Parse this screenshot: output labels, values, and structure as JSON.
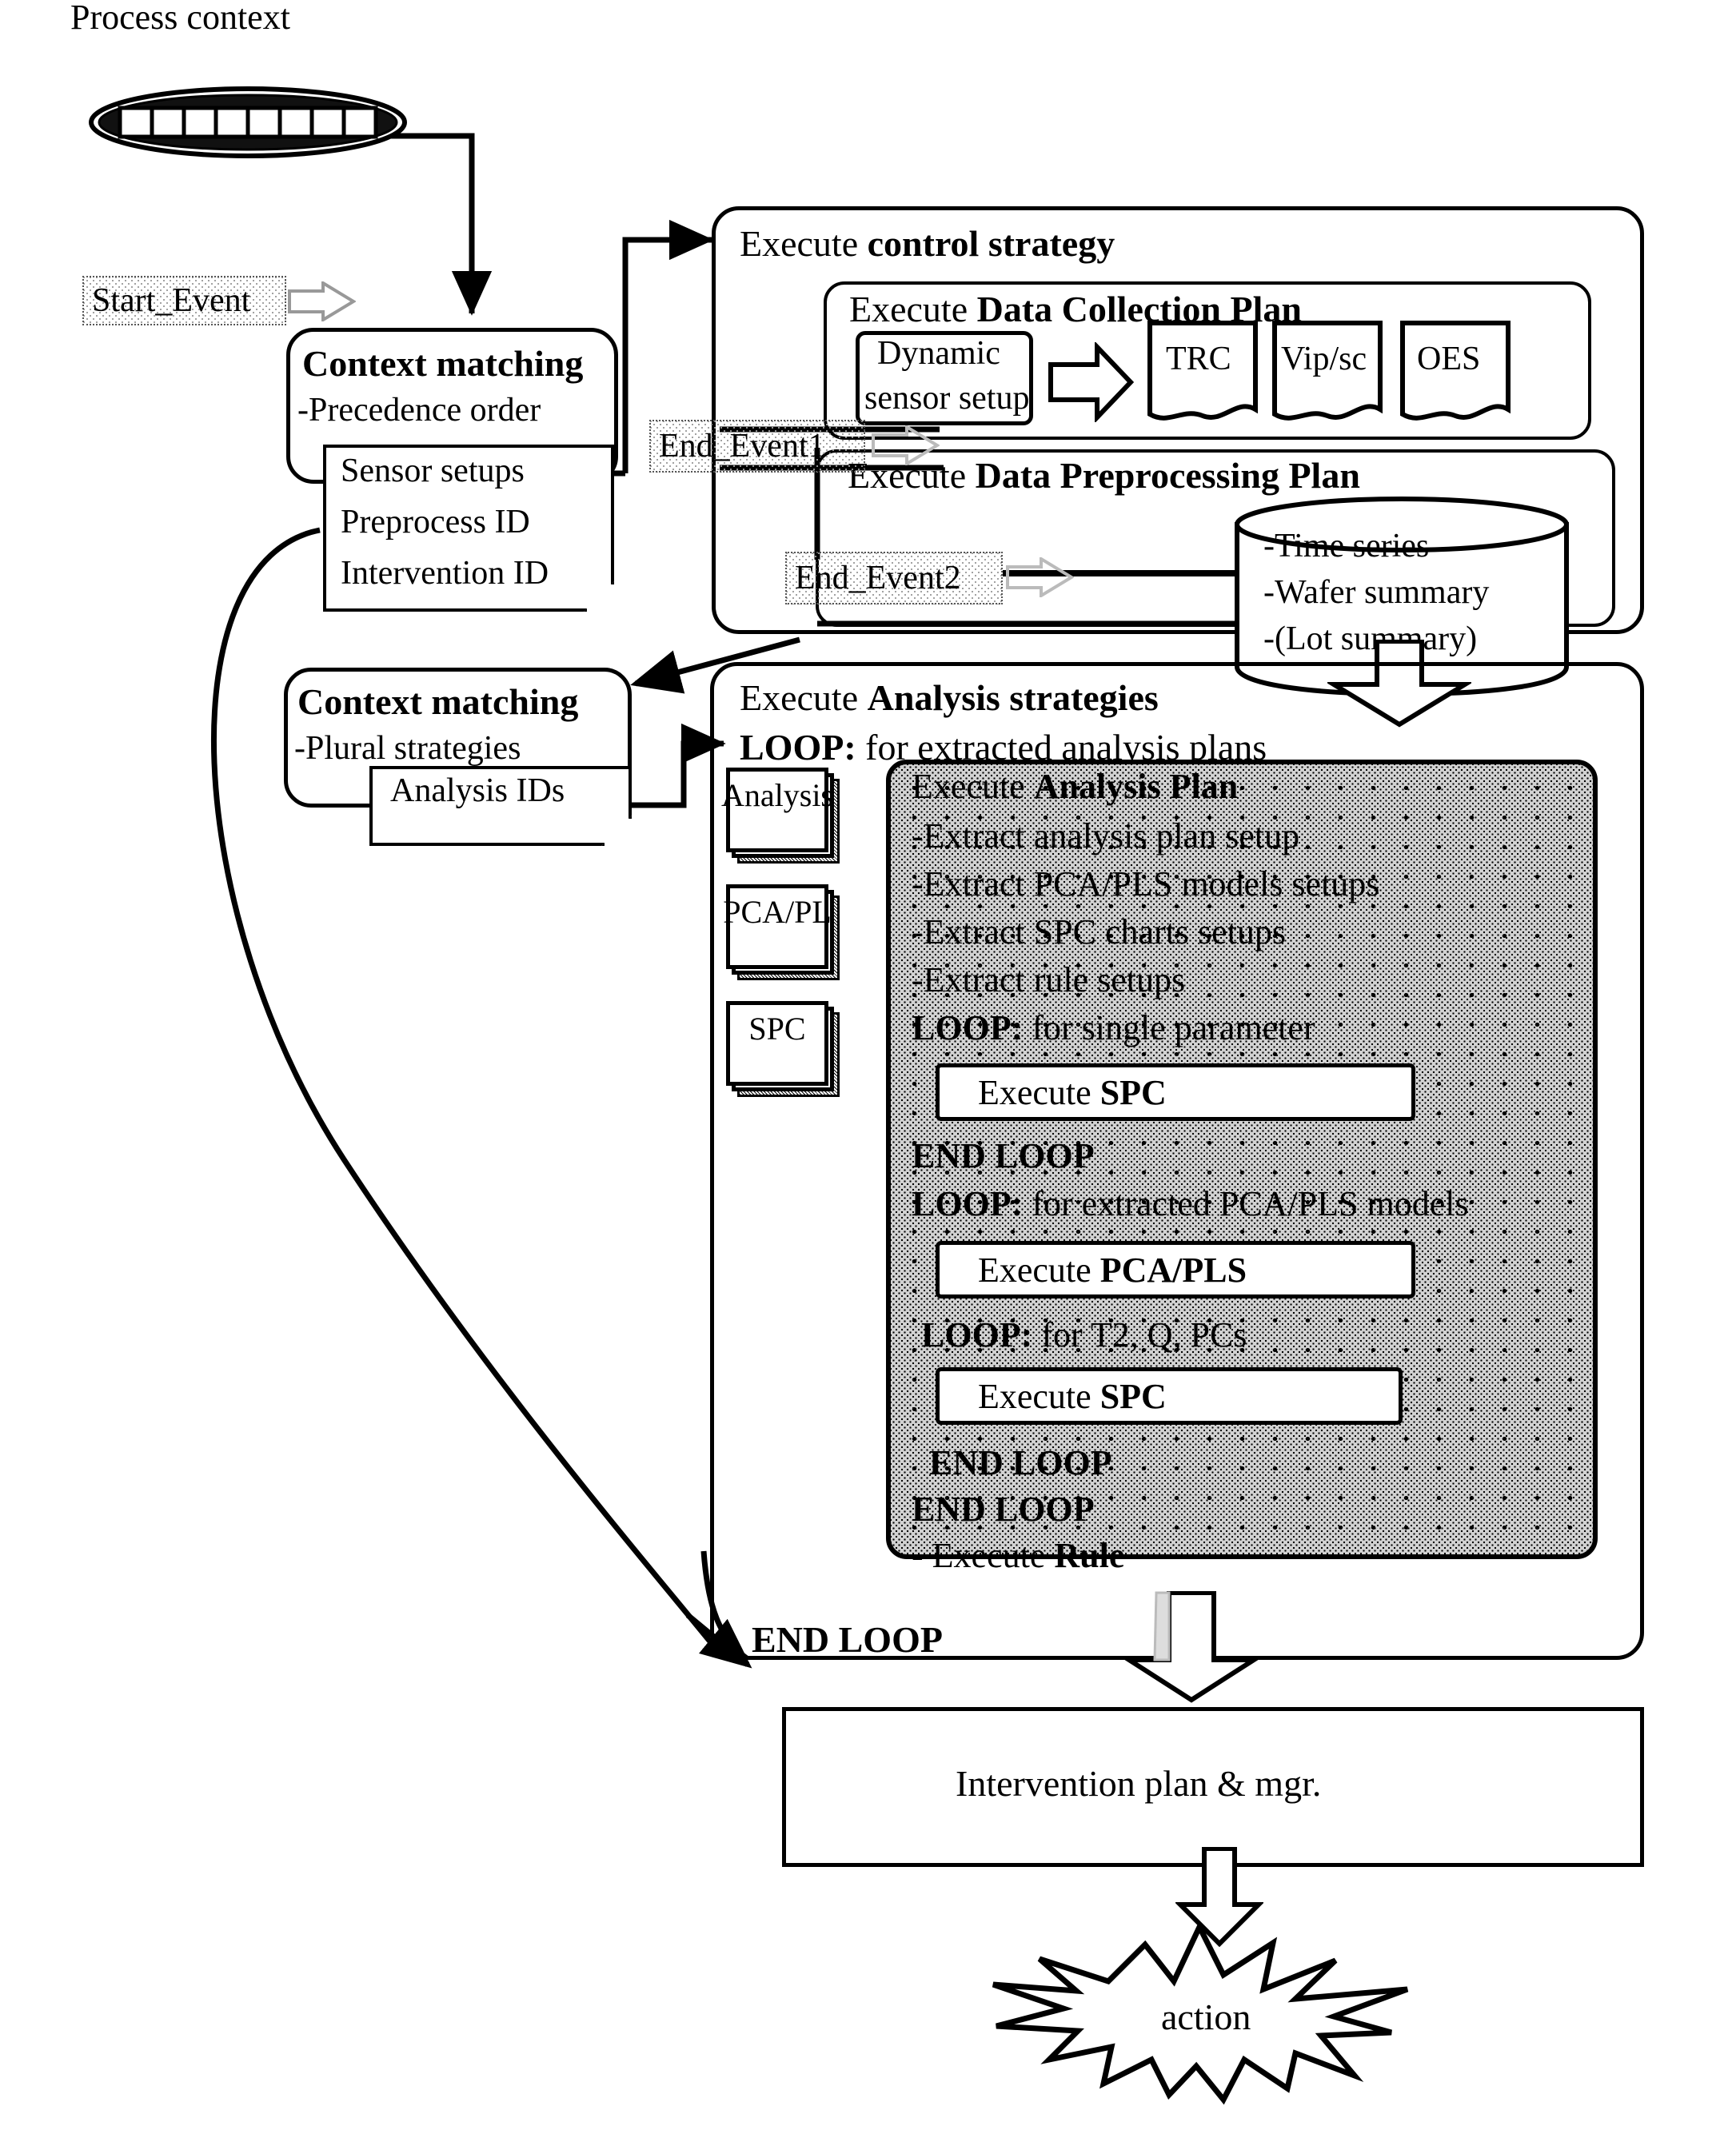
{
  "labels": {
    "process_context": "Process context",
    "start_event": "Start_Event",
    "end_event_1": "End_Event1",
    "end_event_2": "End_Event2",
    "end_loop_outer": "END LOOP"
  },
  "context_matching_1": {
    "title": "Context matching",
    "bullet": "-Precedence order",
    "note_lines": [
      "Sensor setups",
      "Preprocess ID",
      "Intervention ID"
    ]
  },
  "context_matching_2": {
    "title": "Context matching",
    "bullet": "-Plural strategies",
    "note_lines": [
      "Analysis IDs"
    ]
  },
  "control_strategy": {
    "title_prefix": "Execute ",
    "title_bold": "control strategy",
    "data_collection": {
      "title_prefix": "Execute ",
      "title_bold": "Data Collection Plan",
      "source_line1": "Dynamic",
      "source_line2": "sensor setup",
      "outputs": [
        "TRC",
        "Vip/sc",
        "OES"
      ]
    },
    "data_preprocessing": {
      "title_prefix": "Execute ",
      "title_bold": "Data Preprocessing Plan",
      "db_lines": [
        "-Time series",
        "-Wafer summary",
        "-(Lot summary)"
      ]
    }
  },
  "analysis_strategies": {
    "title_prefix": "Execute ",
    "title_bold": "Analysis strategies",
    "loop_header_bold": "LOOP:",
    "loop_header_rest": " for extracted analysis plans",
    "stack_icons": [
      "Analysis",
      "PCA/PL",
      "SPC"
    ],
    "plan_title_prefix": "Execute ",
    "plan_title_bold": "Analysis Plan",
    "plan_bullets": [
      "-Extract analysis plan setup",
      "-Extract PCA/PLS models setups",
      "-Extract SPC charts setups",
      "-Extract rule setups"
    ],
    "loop1_bold": "LOOP:",
    "loop1_rest": " for single parameter",
    "exec_spc_1_prefix": "Execute ",
    "exec_spc_1_bold": "SPC",
    "end_loop_1": "END LOOP",
    "loop2_bold": "LOOP:",
    "loop2_rest": " for extracted PCA/PLS models",
    "exec_pca_prefix": "Execute ",
    "exec_pca_bold": "PCA/PLS",
    "loop3_bold": "LOOP:",
    "loop3_rest": " for T2, Q, PCs",
    "exec_spc_2_prefix": "Execute ",
    "exec_spc_2_bold": "SPC",
    "end_loop_2": "END LOOP",
    "end_loop_3": "END LOOP",
    "exec_rule_prefix": "- Execute ",
    "exec_rule_bold": "Rule"
  },
  "intervention": {
    "label": "Intervention plan & mgr."
  },
  "action": {
    "label": "action"
  },
  "colors": {
    "stroke": "#000000",
    "paper": "#ffffff",
    "stipple_fill": "#d2d2d2",
    "event_fill": "#9a9a9a"
  }
}
